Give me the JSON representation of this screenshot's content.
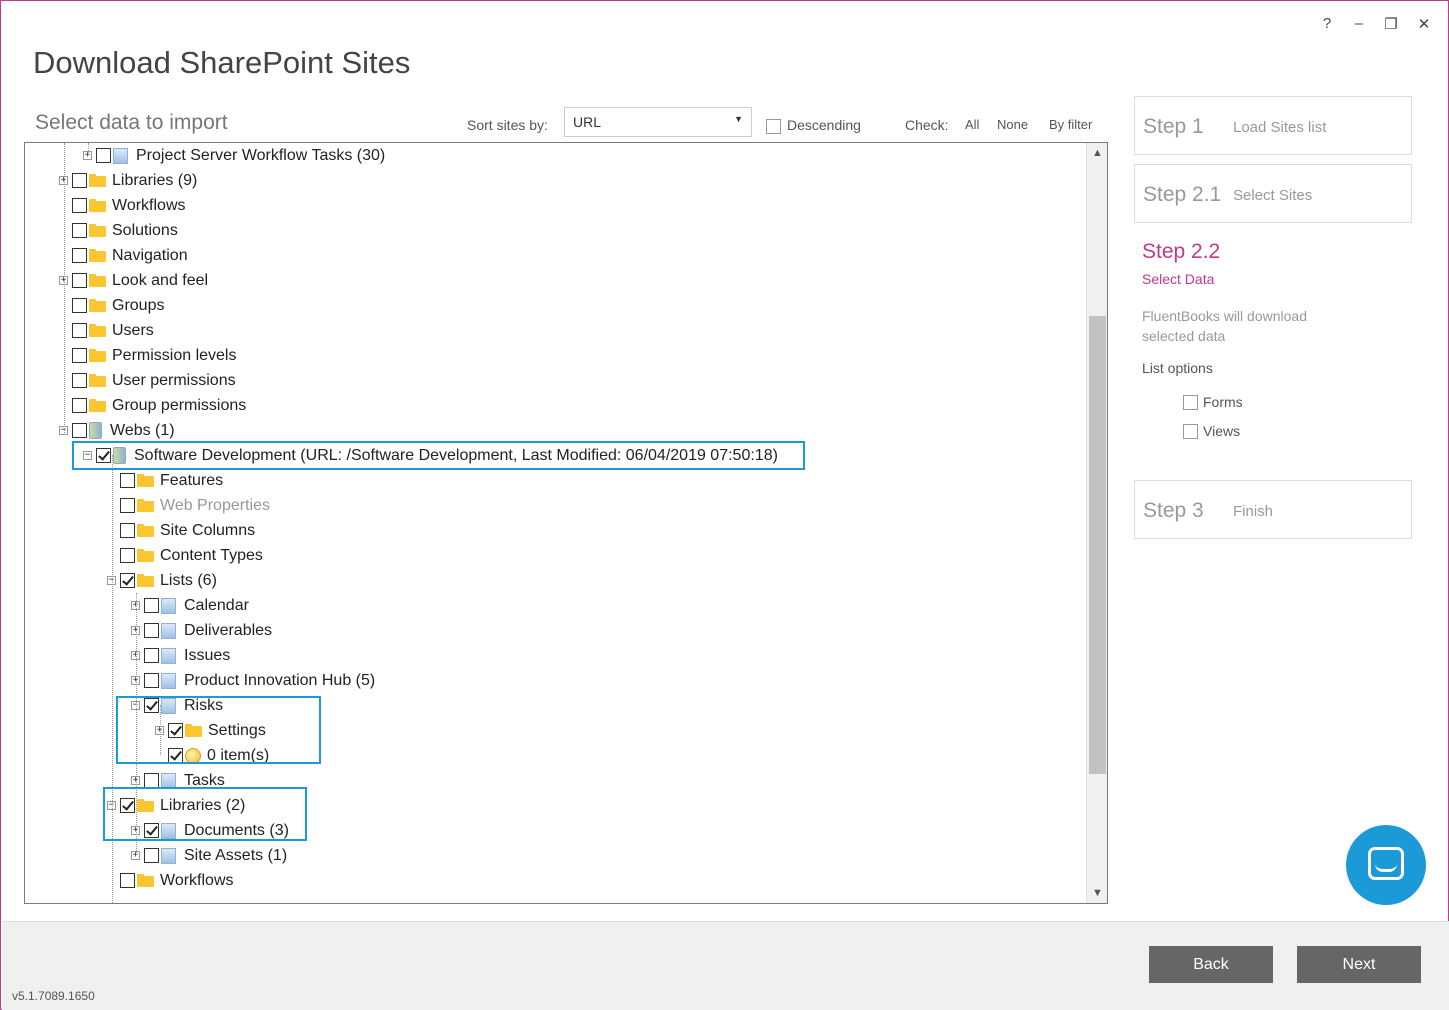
{
  "window": {
    "controls": {
      "help": "?",
      "minimize": "–",
      "restore": "❐",
      "close": "✕"
    }
  },
  "header": {
    "title": "Download SharePoint Sites",
    "subtitle": "Select data to import"
  },
  "toolbar": {
    "sort_label": "Sort sites by:",
    "sort_value": "URL",
    "descending_label": "Descending",
    "descending_checked": false,
    "check_label": "Check:",
    "check_all": "All",
    "check_none": "None",
    "check_by_filter": "By filter"
  },
  "tree": {
    "rows": [
      {
        "label": "Project Server Workflow Tasks (30)",
        "icon": "list-icon",
        "checked": false,
        "expander": "+"
      },
      {
        "label": "Libraries (9)",
        "icon": "folder-icon",
        "checked": false,
        "expander": "+"
      },
      {
        "label": "Workflows",
        "icon": "folder-icon",
        "checked": false,
        "expander": ""
      },
      {
        "label": "Solutions",
        "icon": "folder-icon",
        "checked": false,
        "expander": ""
      },
      {
        "label": "Navigation",
        "icon": "folder-icon",
        "checked": false,
        "expander": ""
      },
      {
        "label": "Look and feel",
        "icon": "folder-icon",
        "checked": false,
        "expander": "+"
      },
      {
        "label": "Groups",
        "icon": "folder-icon",
        "checked": false,
        "expander": ""
      },
      {
        "label": "Users",
        "icon": "folder-icon",
        "checked": false,
        "expander": ""
      },
      {
        "label": "Permission levels",
        "icon": "folder-icon",
        "checked": false,
        "expander": ""
      },
      {
        "label": "User permissions",
        "icon": "folder-icon",
        "checked": false,
        "expander": ""
      },
      {
        "label": "Group permissions",
        "icon": "folder-icon",
        "checked": false,
        "expander": ""
      },
      {
        "label": "Webs (1)",
        "icon": "web-icon",
        "checked": false,
        "expander": "−"
      },
      {
        "label": "Software Development (URL: /Software Development, Last Modified: 06/04/2019 07:50:18)",
        "icon": "web-icon",
        "checked": true,
        "expander": "−"
      },
      {
        "label": "Features",
        "icon": "folder-icon",
        "checked": false,
        "expander": ""
      },
      {
        "label": "Web Properties",
        "icon": "folder-icon",
        "checked": false,
        "expander": "",
        "disabled": true
      },
      {
        "label": "Site Columns",
        "icon": "folder-icon",
        "checked": false,
        "expander": ""
      },
      {
        "label": "Content Types",
        "icon": "folder-icon",
        "checked": false,
        "expander": ""
      },
      {
        "label": "Lists (6)",
        "icon": "folder-icon",
        "checked": true,
        "expander": "−"
      },
      {
        "label": "Calendar",
        "icon": "list-icon",
        "checked": false,
        "expander": "+"
      },
      {
        "label": "Deliverables",
        "icon": "list-icon",
        "checked": false,
        "expander": "+"
      },
      {
        "label": "Issues",
        "icon": "list-icon",
        "checked": false,
        "expander": "+"
      },
      {
        "label": "Product Innovation Hub (5)",
        "icon": "list-icon",
        "checked": false,
        "expander": "+"
      },
      {
        "label": "Risks",
        "icon": "list-icon",
        "checked": true,
        "expander": "−"
      },
      {
        "label": "Settings",
        "icon": "folder-icon",
        "checked": true,
        "expander": "+"
      },
      {
        "label": "0 item(s)",
        "icon": "item-icon",
        "checked": true,
        "expander": ""
      },
      {
        "label": "Tasks",
        "icon": "list-icon",
        "checked": false,
        "expander": "+"
      },
      {
        "label": "Libraries (2)",
        "icon": "folder-icon",
        "checked": true,
        "expander": "−"
      },
      {
        "label": "Documents (3)",
        "icon": "list-icon",
        "checked": true,
        "expander": "+"
      },
      {
        "label": "Site Assets (1)",
        "icon": "list-icon",
        "checked": false,
        "expander": "+"
      },
      {
        "label": "Workflows",
        "icon": "folder-icon",
        "checked": false,
        "expander": ""
      }
    ]
  },
  "steps": {
    "step1": {
      "num": "Step 1",
      "name": "Load Sites list"
    },
    "step21": {
      "num": "Step 2.1",
      "name": "Select Sites"
    },
    "step22": {
      "num": "Step 2.2",
      "name": "Select Data",
      "description": "FluentBooks will download selected data"
    },
    "list_options": {
      "label": "List options",
      "forms": "Forms",
      "views": "Views",
      "forms_checked": false,
      "views_checked": false
    },
    "step3": {
      "num": "Step 3",
      "name": "Finish"
    }
  },
  "footer": {
    "back": "Back",
    "next": "Next",
    "version": "v5.1.7089.1650"
  },
  "colors": {
    "accent": "#c0398a",
    "highlight": "#1b9ad7",
    "button": "#666666"
  }
}
